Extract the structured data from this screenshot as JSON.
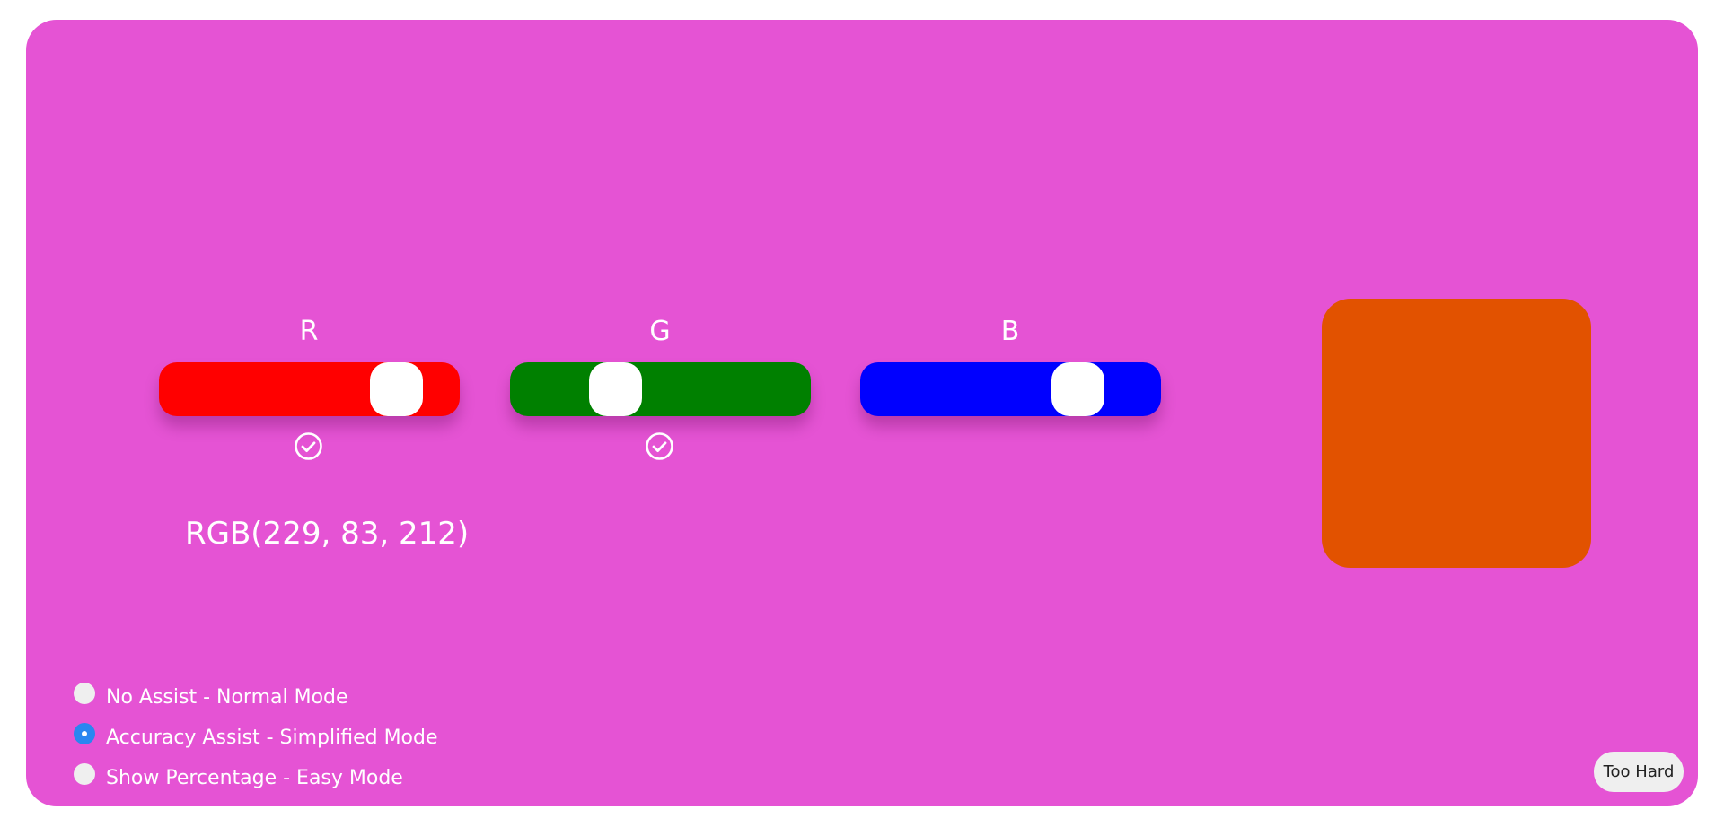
{
  "background_color": "#e553d4",
  "target_color": "#e25200",
  "sliders": [
    {
      "label": "R",
      "color": "#ff0000",
      "fraction": 0.85,
      "checked": true,
      "check_icon": "check-circle-icon"
    },
    {
      "label": "G",
      "color": "#008000",
      "fraction": 0.32,
      "checked": true,
      "check_icon": "check-circle-icon"
    },
    {
      "label": "B",
      "color": "#0000ff",
      "fraction": 0.77,
      "checked": false
    }
  ],
  "rgb_readout": "RGB(229, 83, 212)",
  "modes": [
    {
      "label": "No Assist - Normal Mode",
      "selected": false
    },
    {
      "label": "Accuracy Assist - Simplified Mode",
      "selected": true
    },
    {
      "label": "Show Percentage - Easy Mode",
      "selected": false
    }
  ],
  "too_hard_label": "Too Hard"
}
